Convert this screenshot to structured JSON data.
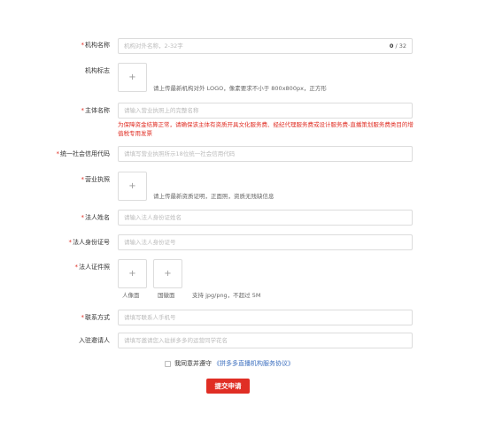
{
  "form": {
    "org_name": {
      "label": "机构名称",
      "required": true,
      "placeholder": "机构对外名称，2-32字",
      "count_current": "0",
      "count_sep": " / ",
      "count_max": "32"
    },
    "org_logo": {
      "label": "机构标志",
      "required": false,
      "upload_icon": "plus-icon",
      "upload_glyph": "+",
      "hint": "请上传最新机构对外 LOGO，像素要求不小于 800x800px，正方形"
    },
    "entity_name": {
      "label": "主体名称",
      "required": true,
      "placeholder": "请输入营业执照上的完整名称",
      "warning": "为保障资金结算正常，请确保该主体有资质开具文化服务费、经纪代理服务费或设计服务费-直播策划服务费类目的增值税专用发票"
    },
    "credit_code": {
      "label": "统一社会信用代码",
      "required": true,
      "placeholder": "请填写营业执照所示18位统一社会信用代码"
    },
    "business_license": {
      "label": "营业执照",
      "required": true,
      "upload_icon": "plus-icon",
      "upload_glyph": "+",
      "hint": "请上传最新资质证明，正面照，资质无残缺信息"
    },
    "legal_name": {
      "label": "法人姓名",
      "required": true,
      "placeholder": "请输入法人身份证姓名"
    },
    "legal_id": {
      "label": "法人身份证号",
      "required": true,
      "placeholder": "请输入法人身份证号"
    },
    "legal_id_photos": {
      "label": "法人证件照",
      "required": true,
      "front_caption": "人像面",
      "back_caption": "国徽面",
      "upload_glyph": "+",
      "hint": "支持 jpg/png，不超过 5M"
    },
    "contact": {
      "label": "联系方式",
      "required": true,
      "placeholder": "请填写联系人手机号"
    },
    "inviter": {
      "label": "入驻邀请人",
      "required": false,
      "placeholder": "请填写邀请您入驻拼多多的运营同学花名"
    }
  },
  "agreement": {
    "text": "我同意并遵守",
    "link": "《拼多多直播机构服务协议》",
    "checked": false
  },
  "submit_label": "提交申请",
  "colors": {
    "accent": "#e02e24",
    "link": "#3c6fbf",
    "border": "#dcdcdc",
    "placeholder": "#bbbbbb"
  }
}
